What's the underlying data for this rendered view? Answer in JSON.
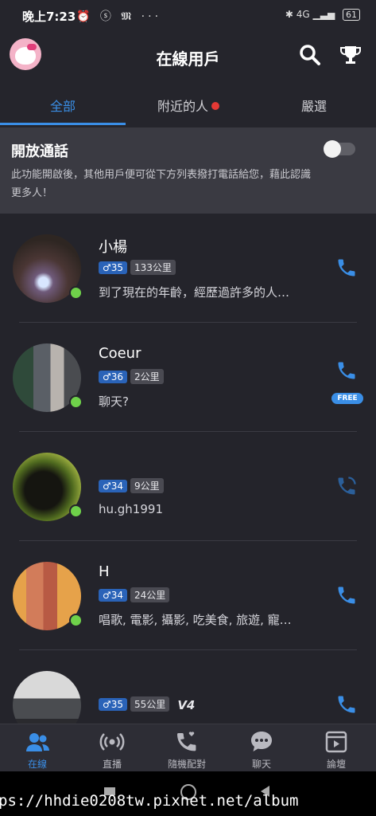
{
  "status_bar": {
    "time": "晚上7:23",
    "icons": "⏰ ⓢ 𝕸 ···",
    "network": "4G",
    "battery": "61"
  },
  "header": {
    "title": "在線用戶",
    "avatar": "cat-avatar",
    "search": "search-icon",
    "ranking": "trophy-icon"
  },
  "tabs": [
    {
      "label": "全部"
    },
    {
      "label": "附近的人"
    },
    {
      "label": "嚴選"
    }
  ],
  "open_call": {
    "title": "開放通話",
    "description": "此功能開啟後，其他用戶便可從下方列表撥打電話給您，藉此認識更多人！",
    "enabled": false
  },
  "users": [
    {
      "name": "小楊",
      "gender_age": "♂35",
      "distance": "133公里",
      "bio": "到了現在的年齡，經歷過許多的人…",
      "online": true
    },
    {
      "name": "Coeur",
      "gender_age": "♂36",
      "distance": "2公里",
      "bio": "聊天?",
      "online": true,
      "badge": "FREE"
    },
    {
      "name": "",
      "gender_age": "♂34",
      "distance": "9公里",
      "bio": "hu.gh1991",
      "online": true
    },
    {
      "name": "H",
      "gender_age": "♂34",
      "distance": "24公里",
      "bio": "唱歌, 電影, 攝影, 吃美食, 旅遊, 寵…",
      "online": true
    },
    {
      "name": "",
      "gender_age": "♂35",
      "distance": "55公里",
      "bio": "",
      "online": false,
      "vip": "V4"
    }
  ],
  "bottom_nav": [
    {
      "label": "在線"
    },
    {
      "label": "直播"
    },
    {
      "label": "隨機配對"
    },
    {
      "label": "聊天"
    },
    {
      "label": "論壇"
    }
  ],
  "watermark": "ps://hhdie0208tw.pixnet.net/album",
  "colors": {
    "accent": "#3a8ee6",
    "background": "#24242b",
    "online": "#6fd14a",
    "alert": "#e53935"
  }
}
